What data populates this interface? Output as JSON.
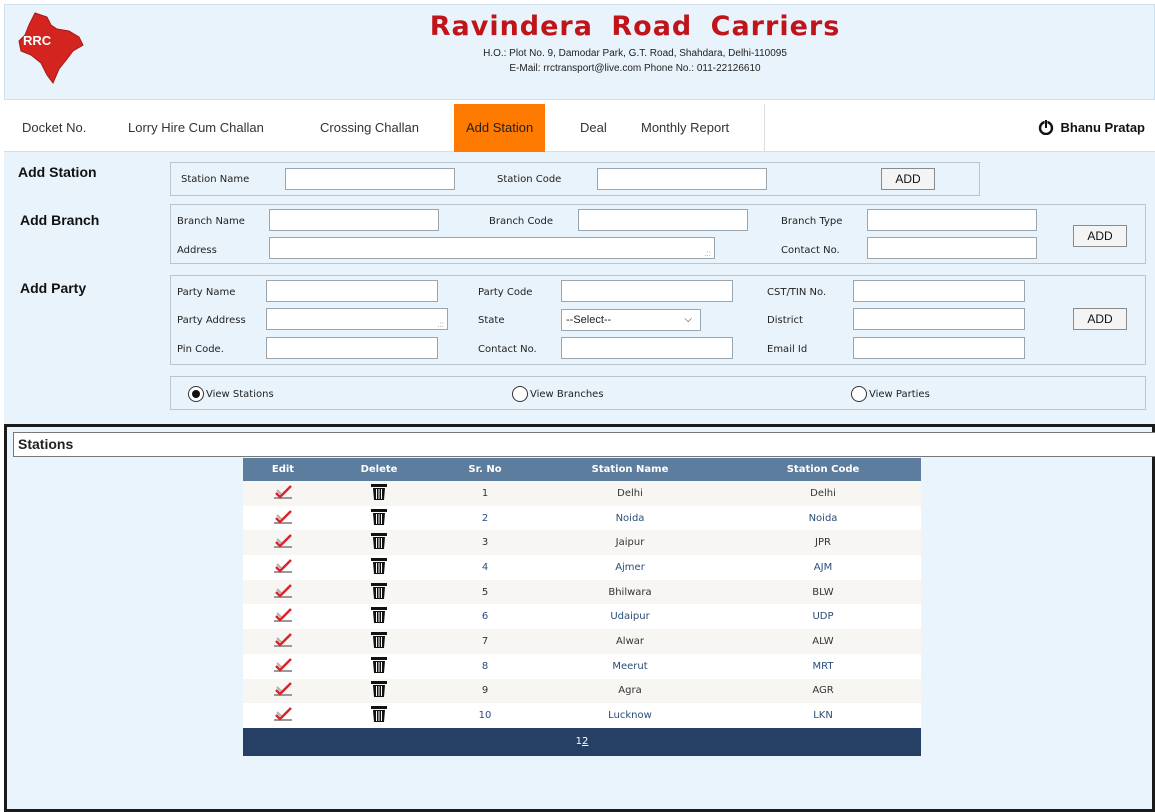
{
  "header": {
    "logo_text": "RRC",
    "company_name": "Ravindera  Road  Carriers",
    "address": "H.O.: Plot No. 9, Damodar Park, G.T. Road, Shahdara, Delhi-110095",
    "contact": "E-Mail: rrctransport@live.com Phone No.: 011-22126610"
  },
  "nav": {
    "items": [
      "Docket No.",
      "Lorry Hire Cum Challan",
      "Crossing Challan",
      "Add Station",
      "Deal",
      "Monthly Report"
    ],
    "active": "Add Station",
    "user_name": "Bhanu Pratap"
  },
  "add_station": {
    "title": "Add Station",
    "station_name_label": "Station Name",
    "station_code_label": "Station Code",
    "add_label": "ADD"
  },
  "add_branch": {
    "title": "Add Branch",
    "branch_name_label": "Branch Name",
    "branch_code_label": "Branch Code",
    "branch_type_label": "Branch Type",
    "address_label": "Address",
    "contact_label": "Contact No.",
    "add_label": "ADD"
  },
  "add_party": {
    "title": "Add Party",
    "party_name_label": "Party Name",
    "party_code_label": "Party Code",
    "cst_label": "CST/TIN No.",
    "party_address_label": "Party Address",
    "state_label": "State",
    "state_value": "--Select--",
    "district_label": "District",
    "pin_label": "Pin Code.",
    "contact_label": "Contact No.",
    "email_label": "Email Id",
    "add_label": "ADD"
  },
  "view_options": {
    "stations": "View Stations",
    "branches": "View Branches",
    "parties": "View Parties",
    "selected": "stations"
  },
  "stations_table": {
    "title": "Stations",
    "columns": [
      "Edit",
      "Delete",
      "Sr. No",
      "Station Name",
      "Station Code"
    ],
    "rows": [
      {
        "sr": "1",
        "name": "Delhi",
        "code": "Delhi"
      },
      {
        "sr": "2",
        "name": "Noida",
        "code": "Noida"
      },
      {
        "sr": "3",
        "name": "Jaipur",
        "code": "JPR"
      },
      {
        "sr": "4",
        "name": "Ajmer",
        "code": "AJM"
      },
      {
        "sr": "5",
        "name": "Bhilwara",
        "code": "BLW"
      },
      {
        "sr": "6",
        "name": "Udaipur",
        "code": "UDP"
      },
      {
        "sr": "7",
        "name": "Alwar",
        "code": "ALW"
      },
      {
        "sr": "8",
        "name": "Meerut",
        "code": "MRT"
      },
      {
        "sr": "9",
        "name": "Agra",
        "code": "AGR"
      },
      {
        "sr": "10",
        "name": "Lucknow",
        "code": "LKN"
      }
    ],
    "pager": {
      "page1": "1",
      "page2": "2"
    }
  },
  "colors": {
    "brand_red": "#c0141b",
    "active_tab": "#ff7a00",
    "table_header": "#5c7d9e",
    "pager_bg": "#263f64",
    "panel_bg": "#e8f3fb"
  }
}
